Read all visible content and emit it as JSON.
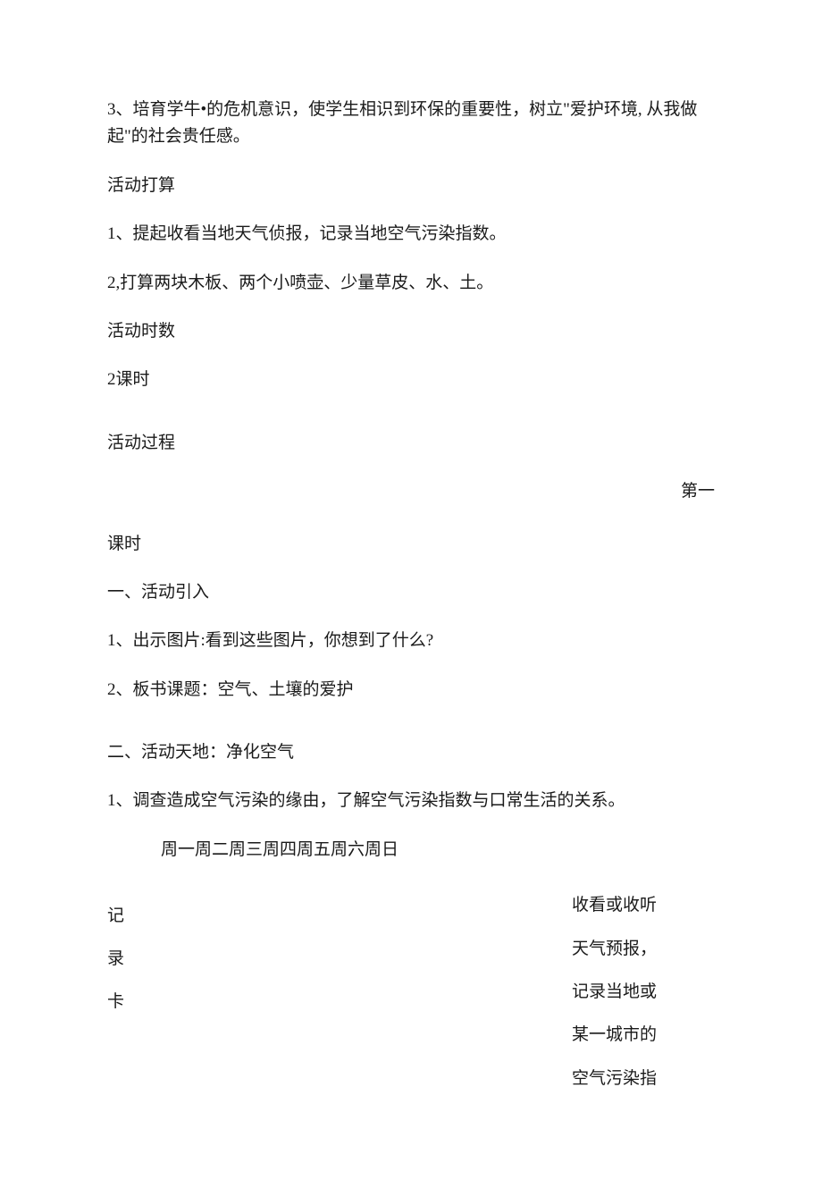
{
  "p3": "3、培育学牛•的危机意识，使学生相识到环保的重要性，树立\"爱护环境, 从我做起\"的社会贵任感。",
  "prepTitle": "活动打算",
  "prep1": "1、提起收看当地天气侦报，记录当地空气污染指数。",
  "prep2": "2,打算两块木板、两个小喷壶、少量草皮、水、土。",
  "hoursTitle": "活动时数",
  "hours": "2课时",
  "processTitle": "活动过程",
  "firstRight": "第一",
  "lessonHour": "课时",
  "sec1Title": "一、活动引入",
  "sec1_1": "1、出示图片:看到这些图片，你想到了什么?",
  "sec1_2": "2、板书课题：空气、土壤的爱护",
  "sec2Title": "二、活动天地：净化空气",
  "sec2_1": "1、调查造成空气污染的缘由，了解空气污染指数与口常生活的关系。",
  "days": "周一周二周三周四周五周六周日",
  "side1": "收看或收听",
  "side2": "天气预报，",
  "side3": "记录当地或",
  "side4": "某一城市的",
  "side5": "空气污染指",
  "left1": "记",
  "left2": "录",
  "left3": "卡"
}
